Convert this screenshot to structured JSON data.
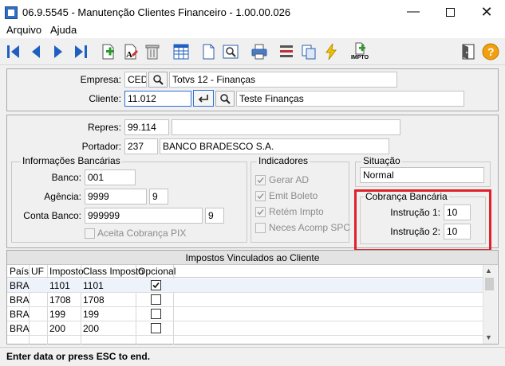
{
  "window": {
    "title": "06.9.5545 - Manutenção Clientes Financeiro - 1.00.00.026",
    "controls": [
      "minimize",
      "maximize",
      "close"
    ]
  },
  "menu": {
    "items": [
      "Arquivo",
      "Ajuda"
    ]
  },
  "toolbar": {
    "icons": [
      "first-record-icon",
      "previous-record-icon",
      "next-record-icon",
      "last-record-icon",
      "add-icon",
      "edit-icon",
      "delete-icon",
      "grid-icon",
      "document-icon",
      "preview-icon",
      "print-icon",
      "list-settings-icon",
      "copy-icon",
      "lightning-icon",
      "impto-icon",
      "exit-icon",
      "help-icon"
    ],
    "impto_label": "IMPTO"
  },
  "header": {
    "empresa_label": "Empresa:",
    "empresa_code": "CED",
    "empresa_name": "Totvs 12 - Finanças",
    "cliente_label": "Cliente:",
    "cliente_code": "11.012",
    "cliente_name": "Teste Finanças"
  },
  "details": {
    "repres_label": "Repres:",
    "repres_code": "99.114",
    "repres_name": "",
    "portador_label": "Portador:",
    "portador_code": "237",
    "portador_name": "BANCO BRADESCO S.A."
  },
  "info_bancarias": {
    "title": "Informações Bancárias",
    "banco_label": "Banco:",
    "banco": "001",
    "agencia_label": "Agência:",
    "agencia": "9999",
    "agencia_dv": "9",
    "conta_label": "Conta Banco:",
    "conta": "999999",
    "conta_dv": "9",
    "pix_label": "Aceita Cobrança PIX",
    "pix_checked": false
  },
  "indicadores": {
    "title": "Indicadores",
    "items": [
      {
        "label": "Gerar AD",
        "checked": true
      },
      {
        "label": "Emit Boleto",
        "checked": true
      },
      {
        "label": "Retém Impto",
        "checked": true
      },
      {
        "label": "Neces Acomp SPC",
        "checked": false
      }
    ]
  },
  "situacao": {
    "title": "Situação",
    "value": "Normal"
  },
  "cobranca": {
    "title": "Cobrança Bancária",
    "instr1_label": "Instrução 1:",
    "instr1": "10",
    "instr2_label": "Instrução 2:",
    "instr2": "10"
  },
  "impostos": {
    "title": "Impostos Vinculados ao Cliente",
    "columns": [
      "País",
      "UF",
      "Imposto",
      "Class Imposto",
      "Opcional"
    ],
    "rows": [
      {
        "pais": "BRA",
        "uf": "",
        "imposto": "1101",
        "class": "1101",
        "opcional": true
      },
      {
        "pais": "BRA",
        "uf": "",
        "imposto": "1708",
        "class": "1708",
        "opcional": false
      },
      {
        "pais": "BRA",
        "uf": "",
        "imposto": "199",
        "class": "199",
        "opcional": false
      },
      {
        "pais": "BRA",
        "uf": "",
        "imposto": "200",
        "class": "200",
        "opcional": false
      }
    ]
  },
  "status": {
    "text": "Enter data or press ESC to end."
  },
  "colors": {
    "highlight": "#e0202a",
    "accent": "#2b6fd6",
    "toolbar_blue": "#1f5fbf",
    "help_orange": "#f0a010"
  }
}
